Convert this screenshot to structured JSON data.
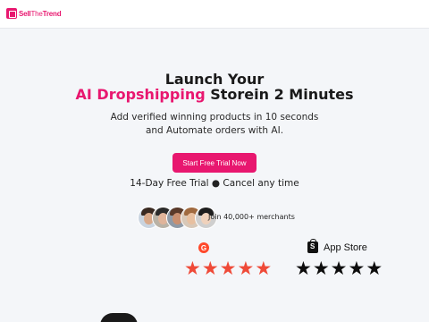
{
  "header": {
    "logo_prefix": "Sell",
    "logo_middle": "The",
    "logo_suffix": "Trend",
    "logo_mark": "brand-logo"
  },
  "hero": {
    "title_line1": "Launch Your",
    "title_accent": "AI Dropshipping",
    "title_rest": " Storein 2 Minutes",
    "subtitle_line1": "Add verified winning products in 10 seconds",
    "subtitle_line2": "and Automate orders with AI.",
    "cta_label": "Start Free Trial Now",
    "trial_note": "14-Day Free Trial ● Cancel any time",
    "join_text": "Join 40,000+ merchants"
  },
  "ratings": {
    "g2_icon": "g2-logo",
    "g2_icon_letter": "G",
    "g2_stars": 5,
    "app_store_label": "App Store",
    "app_store_icon": "shopify-bag-icon",
    "app_store_stars": 5,
    "star_glyph": "★"
  },
  "colors": {
    "brand": "#e8176f",
    "g2_star": "#ef4a38",
    "app_star": "#0d0d0d",
    "background": "#f4f6f9"
  }
}
